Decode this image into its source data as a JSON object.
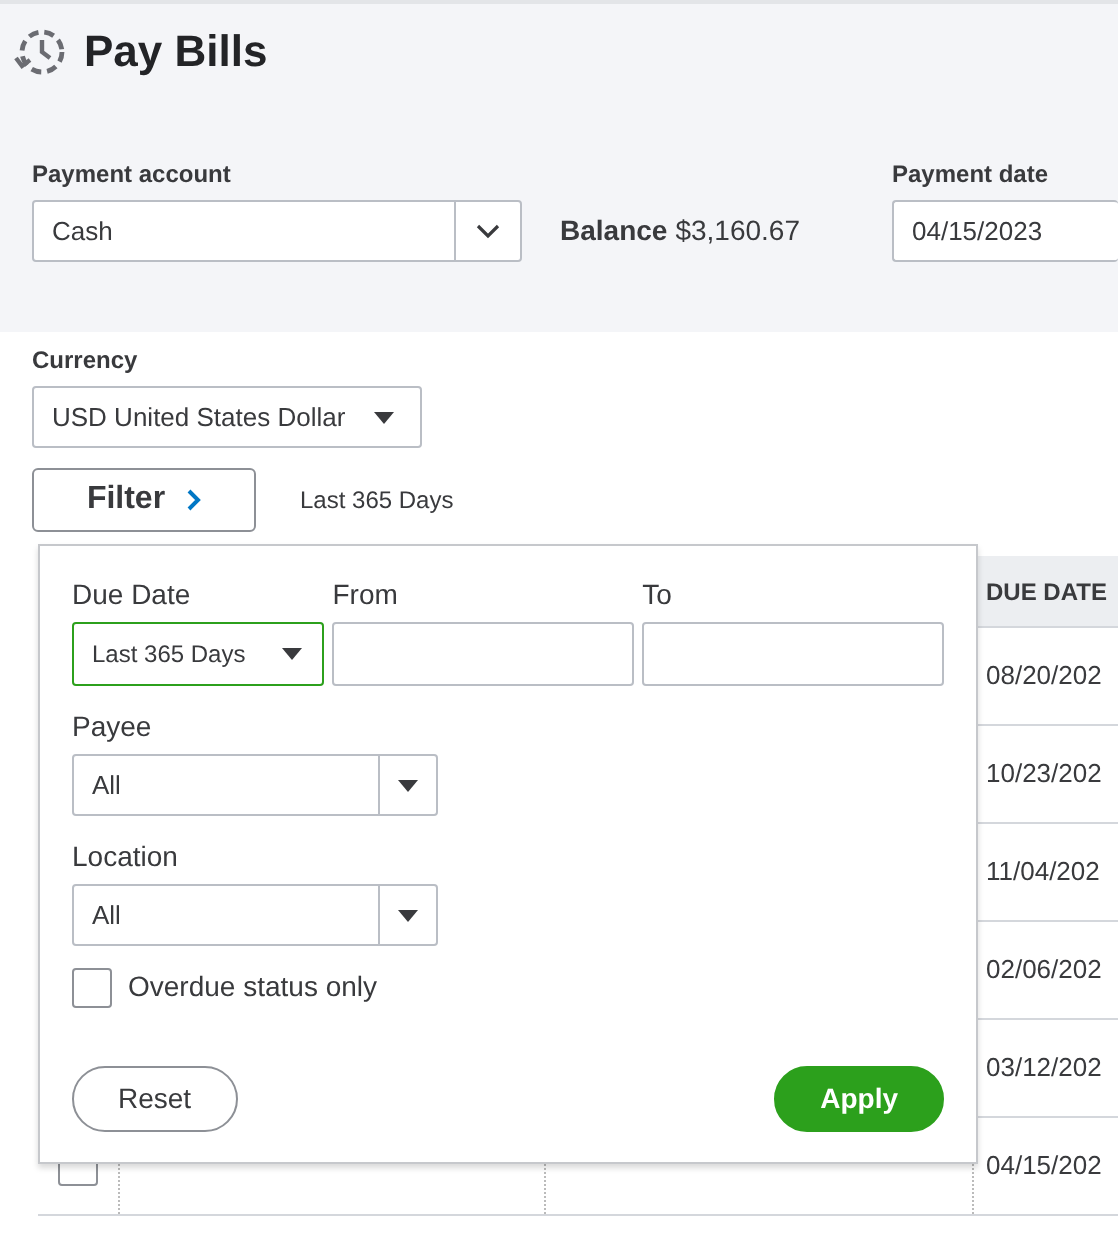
{
  "header": {
    "title": "Pay Bills"
  },
  "payment_account": {
    "label": "Payment account",
    "value": "Cash"
  },
  "balance": {
    "label": "Balance",
    "amount": "$3,160.67"
  },
  "payment_date": {
    "label": "Payment date",
    "value": "04/15/2023"
  },
  "currency": {
    "label": "Currency",
    "value": "USD United States Dollar"
  },
  "filter": {
    "button": "Filter",
    "summary": "Last 365 Days"
  },
  "table": {
    "columns": [
      "DUE DATE"
    ],
    "rows": [
      {
        "due_date": "08/20/202"
      },
      {
        "due_date": "10/23/202"
      },
      {
        "due_date": "11/04/202"
      },
      {
        "due_date": "02/06/202"
      },
      {
        "due_date": "03/12/202"
      },
      {
        "due_date": "04/15/202",
        "checked": false
      }
    ]
  },
  "filter_panel": {
    "due_date": {
      "label": "Due Date",
      "value": "Last 365 Days"
    },
    "from": {
      "label": "From"
    },
    "to": {
      "label": "To"
    },
    "payee": {
      "label": "Payee",
      "value": "All"
    },
    "location": {
      "label": "Location",
      "value": "All"
    },
    "overdue": {
      "label": "Overdue status only",
      "checked": false
    },
    "buttons": [
      {
        "kind": "secondary",
        "label": "Reset"
      },
      {
        "kind": "primary",
        "label": "Apply"
      }
    ]
  }
}
